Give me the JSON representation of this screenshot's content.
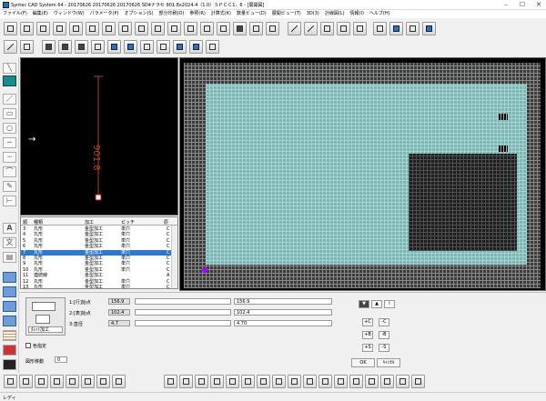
{
  "window": {
    "title": "Syntec CAD System 64 - 20170626 20170626 20170626 SD4ナラセ 901.8x2024.4（1.0）ＳＰＣＣ1．6 - [展開図]",
    "minimize_icon": "minimize-icon",
    "maximize_icon": "maximize-icon",
    "close_icon": "close-icon"
  },
  "menu": [
    "ファイル(F)",
    "編集(E)",
    "ウィンドウ(W)",
    "パラメータ(P)",
    "オプション(S)",
    "部分印刷(O)",
    "参照(R)",
    "計算式(K)",
    "数量ビュー(D)",
    "展開ビュー(T)",
    "3D(3)",
    "計線図(L)",
    "情報(I)",
    "ヘルプ(H)"
  ],
  "preview": {
    "dimension_label": "901.8",
    "arrow_glyph": "→"
  },
  "list": {
    "columns": [
      "順",
      "種類",
      "加工",
      "ピッチ",
      "原"
    ],
    "rows": [
      {
        "no": "3",
        "type": "丸形",
        "proc": "金型加工",
        "pitch": "単穴",
        "orig": "C"
      },
      {
        "no": "4",
        "type": "丸形",
        "proc": "金型加工",
        "pitch": "単穴",
        "orig": "C"
      },
      {
        "no": "5",
        "type": "丸形",
        "proc": "金型加工",
        "pitch": "単穴",
        "orig": "C"
      },
      {
        "no": "6",
        "type": "丸形",
        "proc": "金型加工",
        "pitch": "単穴",
        "orig": "C"
      },
      {
        "no": "7",
        "type": "丸形",
        "proc": "金型加工",
        "pitch": "単穴",
        "orig": "C"
      },
      {
        "no": "8",
        "type": "丸形",
        "proc": "金型加工",
        "pitch": "単穴",
        "orig": "C"
      },
      {
        "no": "9",
        "type": "丸形",
        "proc": "金型加工",
        "pitch": "単穴",
        "orig": "C"
      },
      {
        "no": "10",
        "type": "丸形",
        "proc": "金型加工",
        "pitch": "単穴",
        "orig": "C"
      },
      {
        "no": "11",
        "type": "連続線",
        "proc": "金型加工",
        "pitch": "",
        "orig": "A"
      },
      {
        "no": "12",
        "type": "丸形",
        "proc": "金型加工",
        "pitch": "単穴",
        "orig": "C"
      },
      {
        "no": "13",
        "type": "丸形",
        "proc": "金型加工",
        "pitch": "単穴",
        "orig": "C"
      }
    ],
    "selected_index": 4
  },
  "params": {
    "p1_label": "1:[行]始点",
    "p1_value": "156.9",
    "p2_label": "2:[表]始点",
    "p2_value": "102.4",
    "p3_label": "3:直径",
    "p3_value": "4.7",
    "edit1": "156.9",
    "edit2": "102.4",
    "edit3": "4.70",
    "mode_select": "ﾀﾚｯﾄ加工",
    "checkbox_label": "色指定",
    "move_label": "図形移動",
    "move_value": "0"
  },
  "buttons": {
    "step_plus_c": "+C",
    "step_minus_c": "-C",
    "step_plus_b": "+B",
    "step_minus_b": "-B",
    "step_plus_s": "+S",
    "step_minus_s": "-S",
    "ok": "OK",
    "cancel": "ｷｬﾝｾﾙ",
    "down_icon": "▼",
    "up_icon": "▲",
    "info_icon": "i"
  },
  "left_tools": {
    "text_a": "A",
    "text_bun": "文"
  },
  "status": {
    "text": "レディ"
  },
  "colors": {
    "plate": "#7ab6b4",
    "selected_row": "#2a78d4",
    "dimension": "#b8451f"
  }
}
